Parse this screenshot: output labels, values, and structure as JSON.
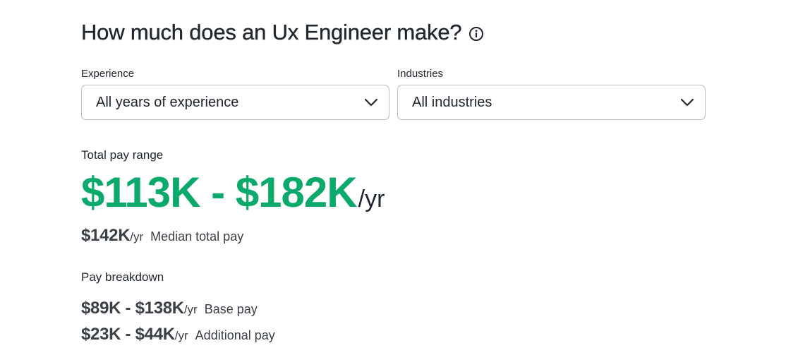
{
  "header": {
    "title": "How much does an Ux Engineer make?",
    "info_icon": "info-circle-icon"
  },
  "filters": {
    "experience": {
      "label": "Experience",
      "value": "All years of experience",
      "icon": "chevron-down-icon"
    },
    "industries": {
      "label": "Industries",
      "value": "All industries",
      "icon": "chevron-down-icon"
    }
  },
  "total_pay": {
    "label": "Total pay range",
    "range": "$113K - $182K",
    "unit": "/yr",
    "median_amount": "$142K",
    "median_unit": "/yr",
    "median_label": "Median total pay"
  },
  "breakdown": {
    "label": "Pay breakdown",
    "items": [
      {
        "amount": "$89K - $138K",
        "unit": "/yr",
        "label": "Base pay"
      },
      {
        "amount": "$23K - $44K",
        "unit": "/yr",
        "label": "Additional pay"
      }
    ]
  },
  "colors": {
    "accent_green": "#0caa6a",
    "text": "#20262e",
    "border": "#b9bcc1"
  }
}
